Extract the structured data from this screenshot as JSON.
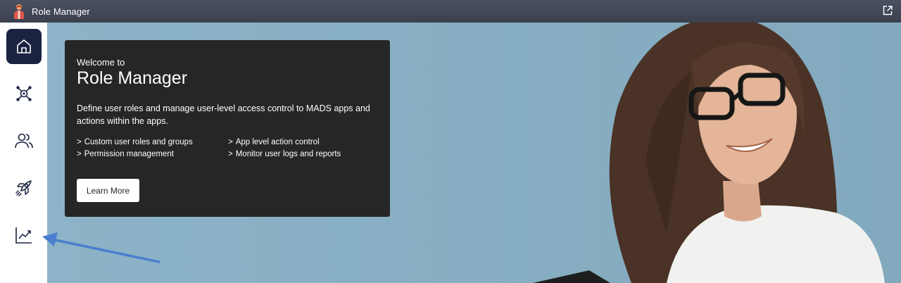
{
  "app": {
    "title": "Role Manager"
  },
  "sidebar": {
    "items": [
      {
        "name": "home",
        "icon": "home-icon",
        "active": true
      },
      {
        "name": "network",
        "icon": "network-icon",
        "active": false
      },
      {
        "name": "users",
        "icon": "users-icon",
        "active": false
      },
      {
        "name": "rocket",
        "icon": "rocket-icon",
        "active": false
      },
      {
        "name": "analytics",
        "icon": "chart-icon",
        "active": false
      }
    ]
  },
  "welcome": {
    "kicker": "Welcome to",
    "heading": "Role Manager",
    "description": "Define user roles and manage user-level access control to MADS apps and actions within the apps.",
    "features": [
      "Custom user roles and groups",
      "App level action control",
      "Permission management",
      "Monitor user logs and reports"
    ],
    "button": "Learn More"
  },
  "colors": {
    "titlebar": "#3f4553",
    "sidebar_active": "#1a2340",
    "hero_bg": "#89b1c5",
    "card_bg": "#262626",
    "annotation_arrow": "#4a7fd0"
  }
}
